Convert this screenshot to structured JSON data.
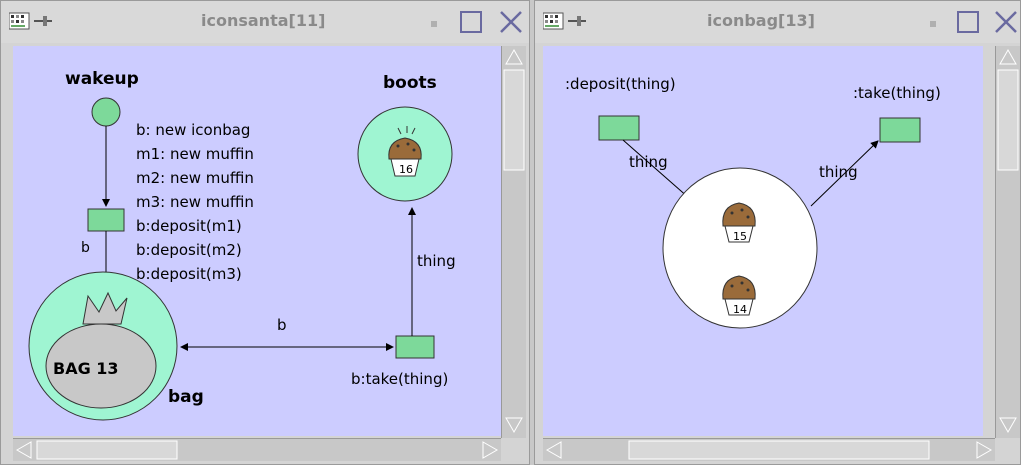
{
  "windows": [
    {
      "title": "iconsanta[11]",
      "diagram": {
        "wakeup_label": "wakeup",
        "boots_label": "boots",
        "bag_label": "bag",
        "bag_text": "BAG 13",
        "code_lines": [
          "b: new iconbag",
          "m1: new muffin",
          "m2: new muffin",
          "m3: new muffin",
          "b:deposit(m1)",
          "b:deposit(m2)",
          "b:deposit(m3)"
        ],
        "edge_b_left": "b",
        "edge_b_mid": "b",
        "edge_thing": "thing",
        "take_label": "b:take(thing)",
        "muffin_number": "16"
      }
    },
    {
      "title": "iconbag[13]",
      "diagram": {
        "deposit_label": ":deposit(thing)",
        "take_label": ":take(thing)",
        "edge_thing_left": "thing",
        "edge_thing_right": "thing",
        "muffin_top": "15",
        "muffin_bottom": "14"
      }
    }
  ],
  "colors": {
    "canvas": "#ccccff",
    "node_green": "#7dd99a",
    "place_fill": "#9ff5d2"
  }
}
